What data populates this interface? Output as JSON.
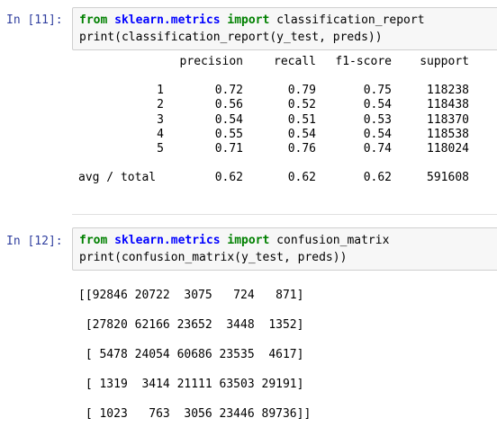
{
  "cells": [
    {
      "prompt": "In [11]:",
      "code": [
        {
          "kw1": "from",
          "module": "sklearn.metrics",
          "kw2": "import",
          "rest": "classification_report"
        },
        {
          "text": "print(classification_report(y_test, preds))"
        }
      ]
    },
    {
      "prompt": "In [12]:",
      "code": [
        {
          "kw1": "from",
          "module": "sklearn.metrics",
          "kw2": "import",
          "rest": "confusion_matrix"
        },
        {
          "text": "print(confusion_matrix(y_test, preds))"
        }
      ]
    }
  ],
  "report": {
    "headers": [
      "precision",
      "recall",
      "f1-score",
      "support"
    ],
    "rows": [
      {
        "label": "1",
        "precision": "0.72",
        "recall": "0.79",
        "f1": "0.75",
        "support": "118238"
      },
      {
        "label": "2",
        "precision": "0.56",
        "recall": "0.52",
        "f1": "0.54",
        "support": "118438"
      },
      {
        "label": "3",
        "precision": "0.54",
        "recall": "0.51",
        "f1": "0.53",
        "support": "118370"
      },
      {
        "label": "4",
        "precision": "0.55",
        "recall": "0.54",
        "f1": "0.54",
        "support": "118538"
      },
      {
        "label": "5",
        "precision": "0.71",
        "recall": "0.76",
        "f1": "0.74",
        "support": "118024"
      }
    ],
    "total": {
      "label": "avg / total",
      "precision": "0.62",
      "recall": "0.62",
      "f1": "0.62",
      "support": "591608"
    }
  },
  "confusion_matrix": [
    "[[92846 20722  3075   724   871]",
    " [27820 62166 23652  3448  1352]",
    " [ 5478 24054 60686 23535  4617]",
    " [ 1319  3414 21111 63503 29191]",
    " [ 1023   763  3056 23446 89736]]"
  ]
}
